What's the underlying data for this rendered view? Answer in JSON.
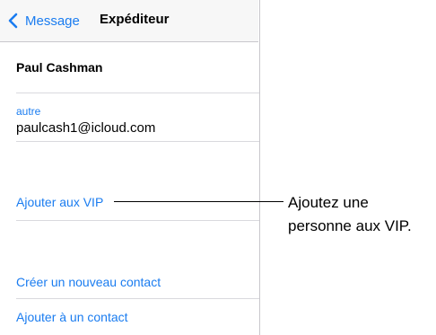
{
  "nav": {
    "back_label": "Message",
    "title": "Expéditeur"
  },
  "contact": {
    "name": "Paul Cashman",
    "email_label": "autre",
    "email_value": "paulcash1@icloud.com"
  },
  "actions": {
    "add_vip": "Ajouter aux VIP",
    "create_contact": "Créer un nouveau contact",
    "add_to_contact": "Ajouter à un contact"
  },
  "callout": {
    "line1": "Ajoutez une",
    "line2": "personne aux VIP."
  },
  "colors": {
    "accent": "#1a7cf0",
    "navbar_bg": "#f7f7f7",
    "separator": "#d9d9de"
  }
}
